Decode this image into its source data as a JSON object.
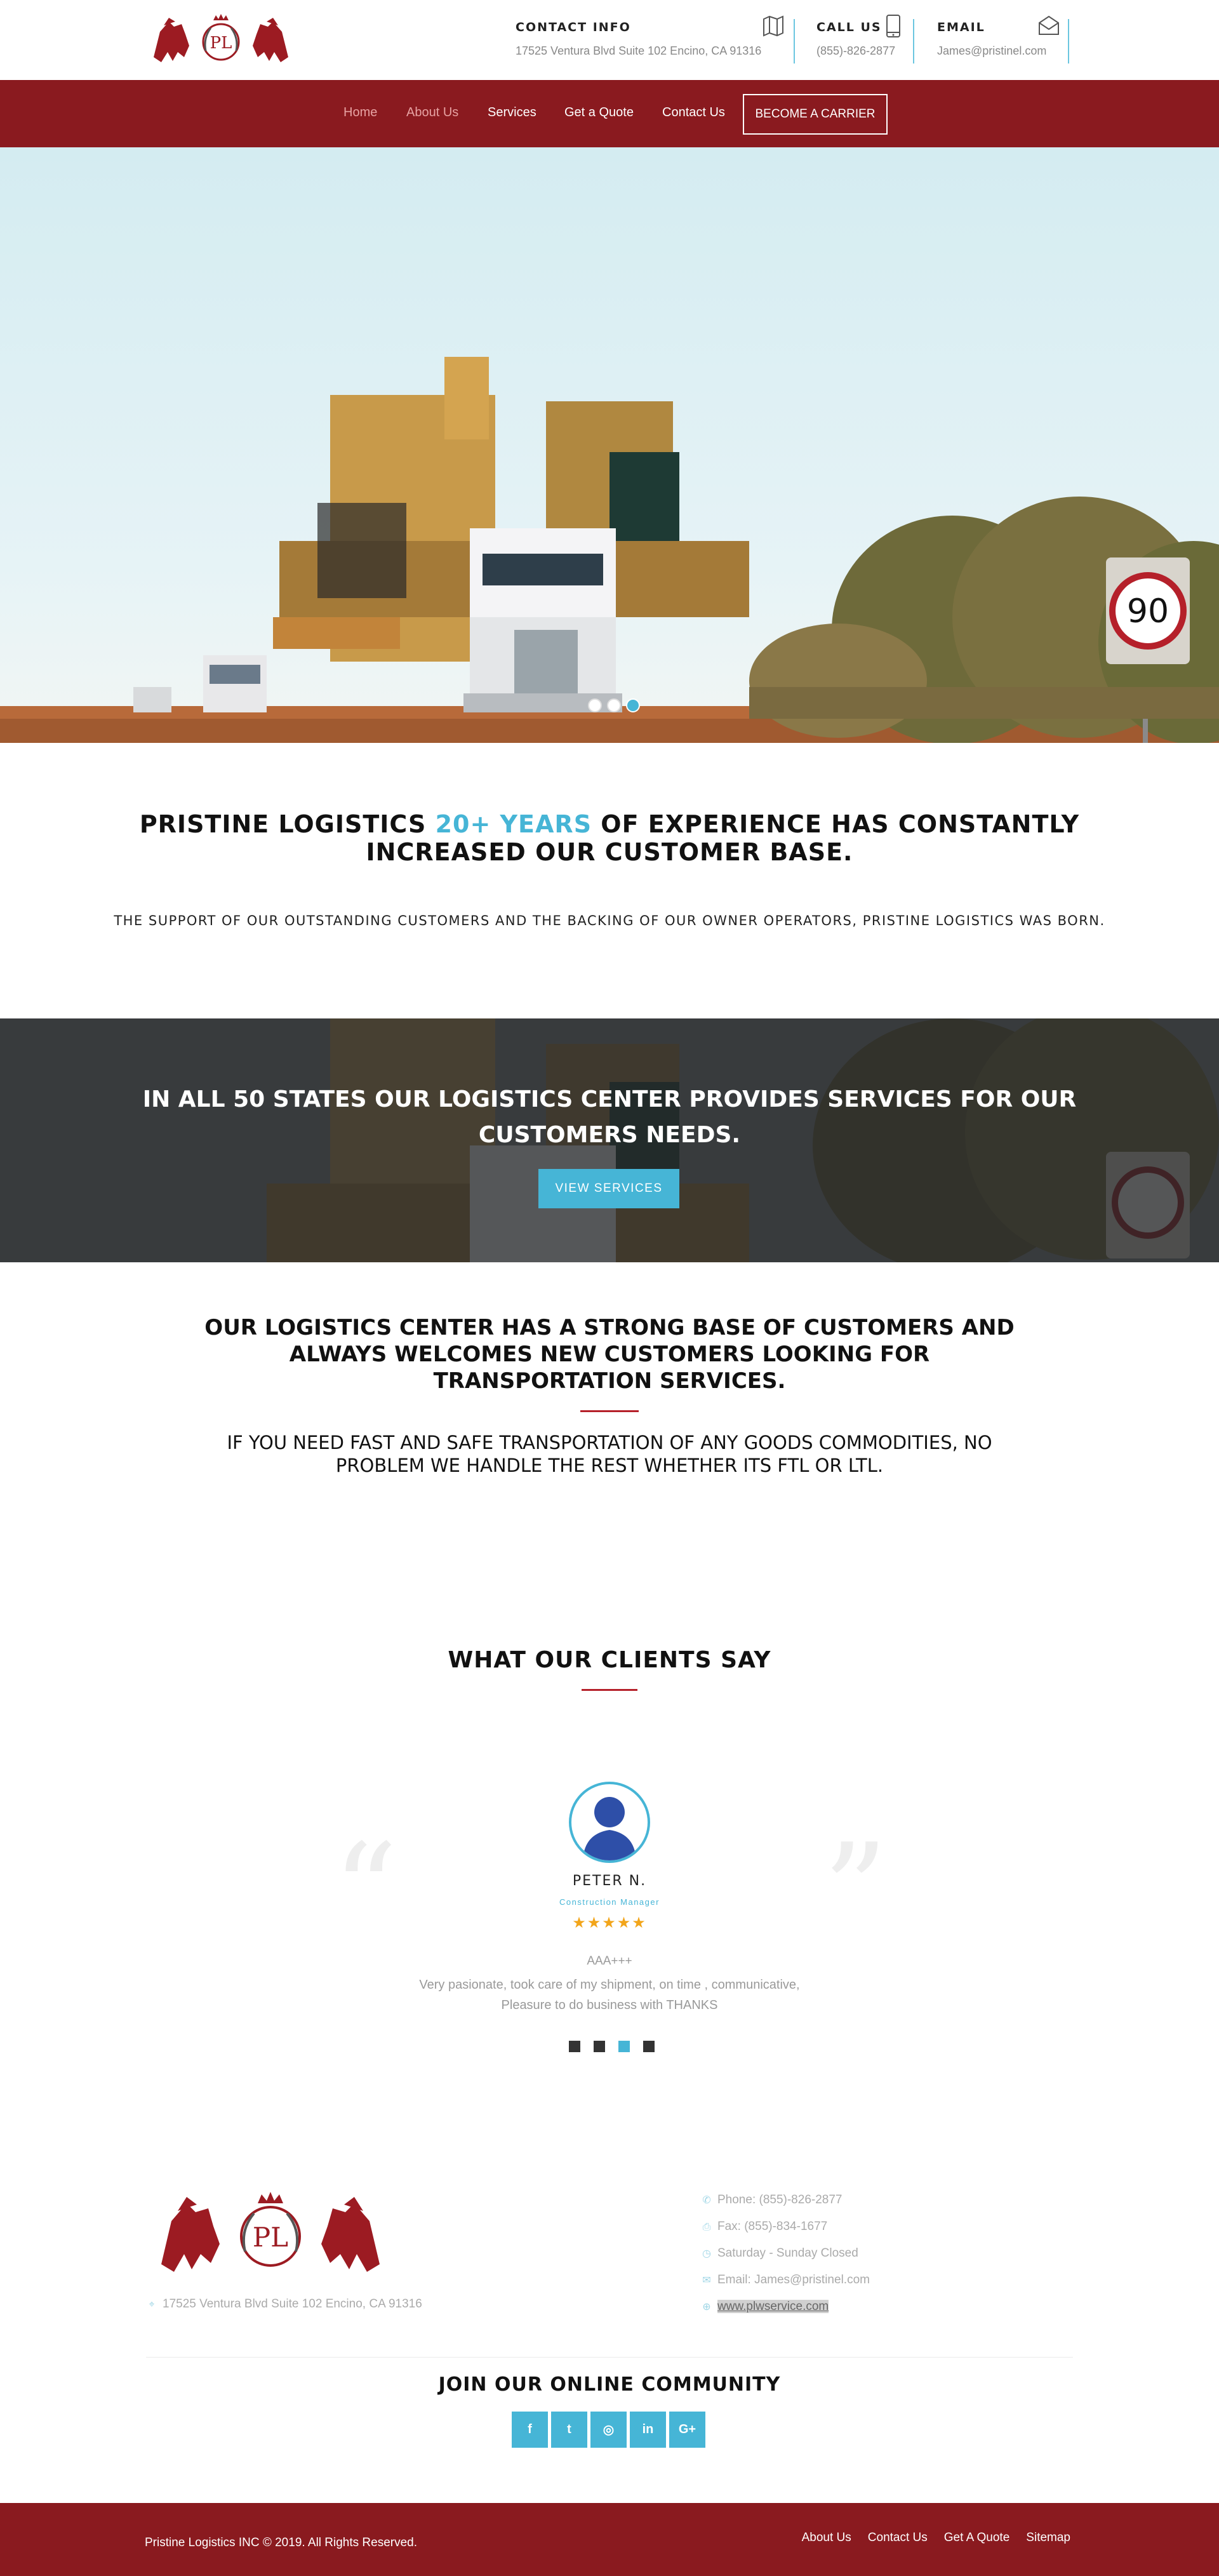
{
  "brand": {
    "logo_monogram": "PL",
    "primary_color": "#8a1a1f",
    "accent_color": "#46b5d6"
  },
  "contact_header": {
    "info": {
      "title": "CONTACT INFO",
      "value": "17525 Ventura Blvd Suite 102 Encino, CA 91316",
      "icon": "map-icon"
    },
    "phone": {
      "title": "CALL US",
      "value": "(855)-826-2877",
      "icon": "mobile-phone-icon"
    },
    "email": {
      "title": "EMAIL",
      "value": "James@pristinel.com",
      "icon": "envelope-icon"
    }
  },
  "nav": {
    "items": [
      {
        "label": "Home"
      },
      {
        "label": "About Us"
      },
      {
        "label": "Services"
      },
      {
        "label": "Get a Quote"
      },
      {
        "label": "Contact Us"
      }
    ],
    "cta": "BECOME A CARRIER"
  },
  "hero": {
    "sign_number": "90",
    "slides": [
      {
        "active": false
      },
      {
        "active": false
      },
      {
        "active": true
      }
    ]
  },
  "intro": {
    "heading_pre": "PRISTINE LOGISTICS ",
    "heading_accent": "20+ YEARS",
    "heading_post": " OF EXPERIENCE HAS CONSTANTLY INCREASED OUR CUSTOMER BASE.",
    "subtext": "THE SUPPORT OF OUR OUTSTANDING CUSTOMERS AND THE BACKING OF OUR OWNER OPERATORS, PRISTINE LOGISTICS WAS BORN."
  },
  "banner": {
    "heading": "IN ALL 50 STATES OUR LOGISTICS CENTER PROVIDES SERVICES FOR OUR CUSTOMERS NEEDS.",
    "button": "VIEW SERVICES"
  },
  "base": {
    "heading": "OUR LOGISTICS CENTER HAS A STRONG BASE OF CUSTOMERS AND ALWAYS WELCOMES NEW CUSTOMERS LOOKING FOR TRANSPORTATION SERVICES.",
    "subtext": "IF YOU NEED FAST AND SAFE TRANSPORTATION OF ANY GOODS COMMODITIES, NO PROBLEM WE HANDLE THE REST WHETHER ITS FTL OR LTL."
  },
  "testimonials": {
    "heading": "WHAT OUR CLIENTS SAY",
    "current": {
      "name": "PETER N.",
      "role": "Construction Manager",
      "rating": 5,
      "stars": "★★★★★",
      "title": "AAA+++",
      "text_line1": "Very pasionate, took care of my shipment, on time , communicative,",
      "text_line2": "Pleasure to do business with THANKS"
    },
    "pager": [
      {
        "active": false
      },
      {
        "active": false
      },
      {
        "active": true
      },
      {
        "active": false
      }
    ]
  },
  "footer": {
    "address": "17525 Ventura Blvd Suite 102 Encino, CA 91316",
    "contacts": [
      {
        "icon": "phone-icon",
        "glyph": "✆",
        "text": "Phone: (855)-826-2877"
      },
      {
        "icon": "fax-icon",
        "glyph": "⎙",
        "text": "Fax: (855)-834-1677"
      },
      {
        "icon": "clock-icon",
        "glyph": "◷",
        "text": "Saturday - Sunday Closed"
      },
      {
        "icon": "envelope-icon",
        "glyph": "✉",
        "text": "Email: James@pristinel.com"
      },
      {
        "icon": "globe-icon",
        "glyph": "⊕",
        "text": "www.plwservice.com"
      }
    ],
    "community_heading": "JOIN OUR ONLINE COMMUNITY",
    "socials": [
      {
        "icon": "facebook-icon",
        "glyph": "f"
      },
      {
        "icon": "twitter-icon",
        "glyph": "t"
      },
      {
        "icon": "instagram-icon",
        "glyph": "◎"
      },
      {
        "icon": "linkedin-icon",
        "glyph": "in"
      },
      {
        "icon": "google-plus-icon",
        "glyph": "G+"
      }
    ]
  },
  "bottom_bar": {
    "copyright": "Pristine Logistics INC © 2019. All Rights Reserved.",
    "links": [
      "About Us",
      "Contact Us",
      "Get A Quote",
      "Sitemap"
    ]
  }
}
